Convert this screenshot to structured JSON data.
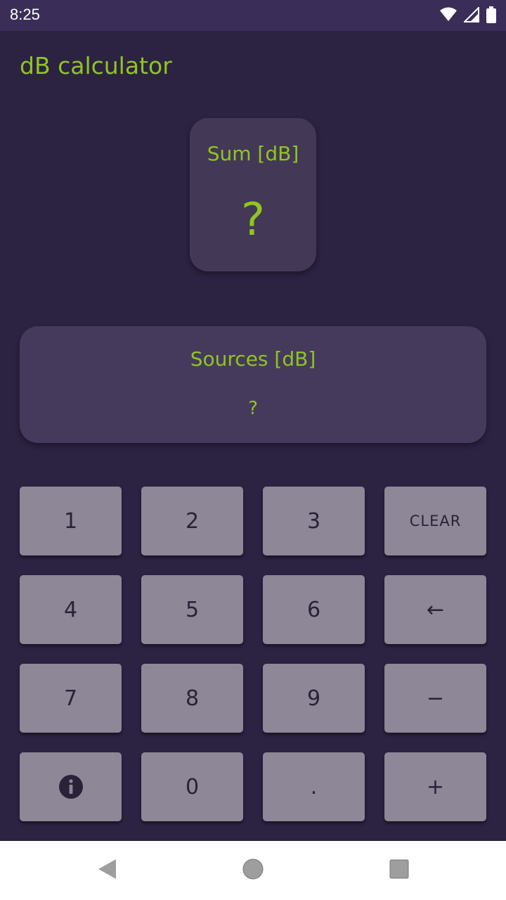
{
  "status_bar": {
    "time": "8:25",
    "icons": [
      "wifi-icon",
      "signal-icon",
      "battery-icon"
    ]
  },
  "app": {
    "title": "dB calculator"
  },
  "sum_card": {
    "label": "Sum [dB]",
    "value": "?"
  },
  "sources_card": {
    "label": "Sources [dB]",
    "value": "?"
  },
  "keypad": {
    "key_1": "1",
    "key_2": "2",
    "key_3": "3",
    "clear": "CLEAR",
    "key_4": "4",
    "key_5": "5",
    "key_6": "6",
    "backspace": "←",
    "key_7": "7",
    "key_8": "8",
    "key_9": "9",
    "minus": "−",
    "info_icon": "info-icon",
    "key_0": "0",
    "dot": ".",
    "plus": "+"
  },
  "nav_bar": {
    "icons": [
      "back-icon",
      "home-icon",
      "recents-icon"
    ]
  },
  "colors": {
    "accent": "#8fc61f",
    "background": "#2c2242",
    "card": "#463a5c",
    "key": "#8d8797",
    "status_bar": "#3a2e58"
  }
}
